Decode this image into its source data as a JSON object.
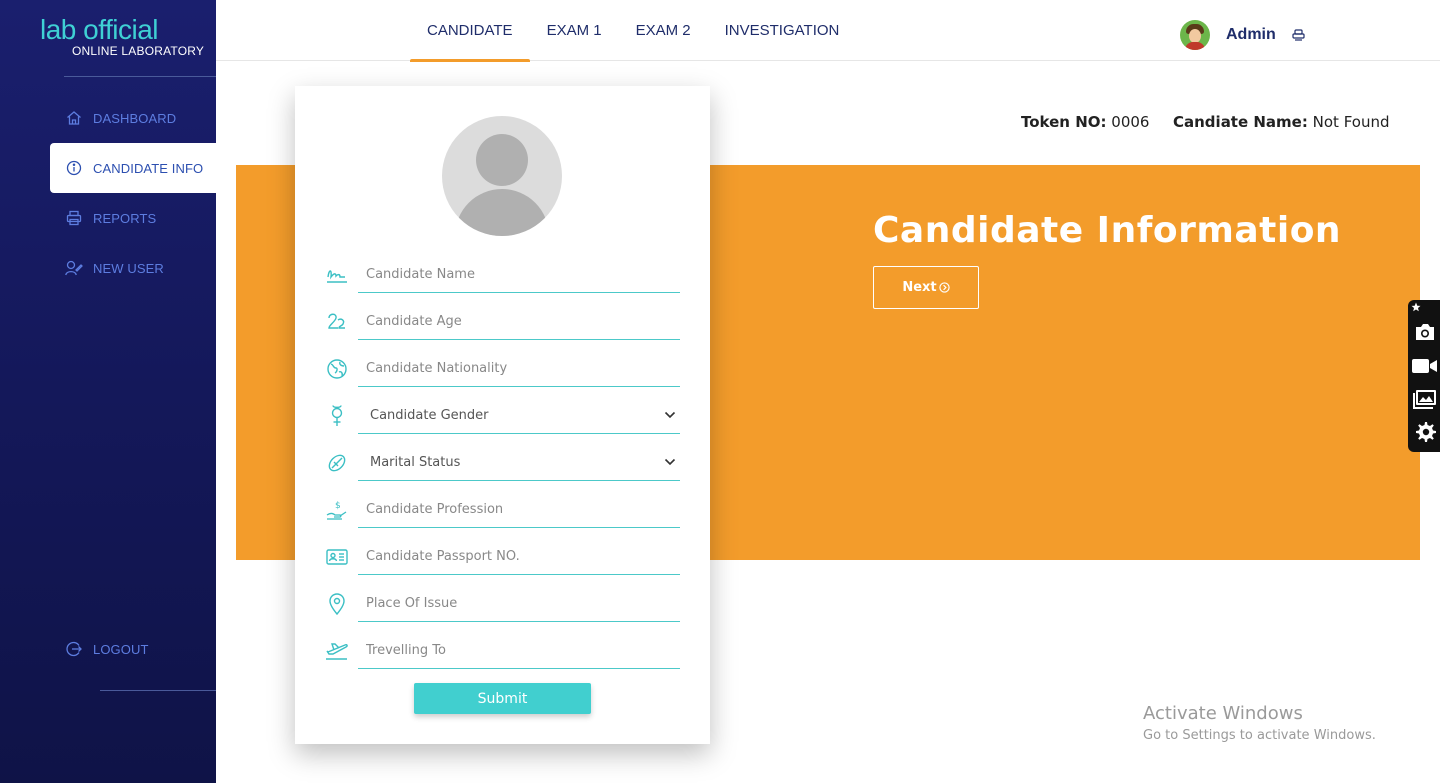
{
  "brand": {
    "name": "lab official",
    "subtitle": "ONLINE LABORATORY"
  },
  "sidebar": {
    "items": [
      {
        "label": "DASHBOARD",
        "icon": "home-icon"
      },
      {
        "label": "CANDIDATE INFO",
        "icon": "info-icon",
        "active": true
      },
      {
        "label": "REPORTS",
        "icon": "printer-icon"
      },
      {
        "label": "NEW USER",
        "icon": "user-add-icon"
      }
    ],
    "logout_label": "LOGOUT"
  },
  "topnav": {
    "tabs": [
      {
        "label": "CANDIDATE",
        "active": true
      },
      {
        "label": "EXAM 1"
      },
      {
        "label": "EXAM 2"
      },
      {
        "label": "INVESTIGATION"
      }
    ],
    "user_name": "Admin"
  },
  "info": {
    "token_label": "Token NO:",
    "token_value": "0006",
    "name_label": "Candiate Name:",
    "name_value": "Not Found"
  },
  "banner": {
    "title": "Candidate Information",
    "next_label": "Next"
  },
  "form": {
    "fields": [
      {
        "placeholder": "Candidate Name",
        "icon": "signature-icon"
      },
      {
        "placeholder": "Candidate Age",
        "icon": "age-icon"
      },
      {
        "placeholder": "Candidate Nationality",
        "icon": "globe-icon"
      },
      {
        "placeholder": "Candidate Gender",
        "icon": "gender-icon",
        "type": "select"
      },
      {
        "placeholder": "Marital Status",
        "icon": "ring-icon",
        "type": "select"
      },
      {
        "placeholder": "Candidate Profession",
        "icon": "salary-icon"
      },
      {
        "placeholder": "Candidate Passport NO.",
        "icon": "id-card-icon"
      },
      {
        "placeholder": "Place Of Issue",
        "icon": "location-pin-icon"
      },
      {
        "placeholder": "Trevelling To",
        "icon": "airplane-icon"
      }
    ],
    "submit_label": "Submit"
  },
  "watermark": {
    "title": "Activate Windows",
    "subtitle": "Go to Settings to activate Windows."
  },
  "colors": {
    "sidebar": "#1a1f6e",
    "accent": "#f39c2b",
    "teal": "#41cfcf",
    "nav_text": "#5d7de0"
  }
}
